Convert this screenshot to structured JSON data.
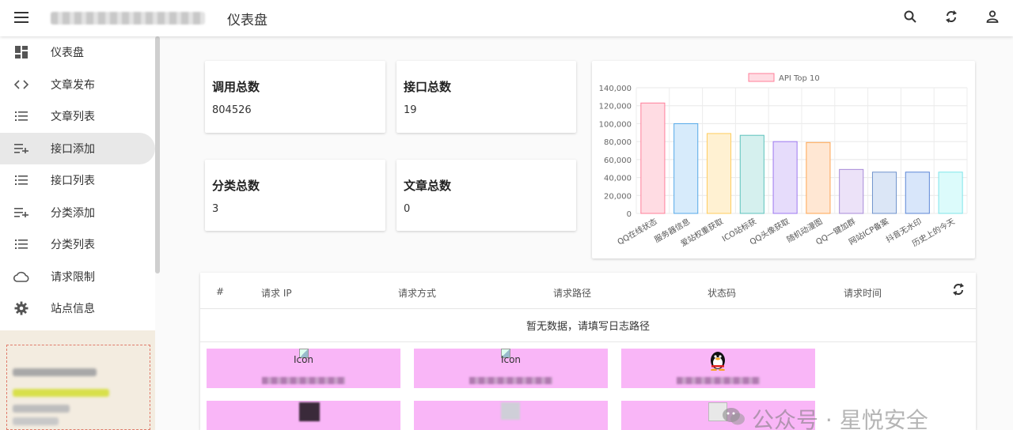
{
  "header": {
    "title": "仪表盘",
    "icons": [
      "menu-icon",
      "search-icon",
      "refresh-icon",
      "account-icon"
    ]
  },
  "sidebar": {
    "items": [
      {
        "label": "仪表盘",
        "icon": "dashboard-icon"
      },
      {
        "label": "文章发布",
        "icon": "code-icon"
      },
      {
        "label": "文章列表",
        "icon": "list-icon"
      },
      {
        "label": "接口添加",
        "icon": "playlist-add-icon",
        "active": true
      },
      {
        "label": "接口列表",
        "icon": "list-icon"
      },
      {
        "label": "分类添加",
        "icon": "playlist-add-icon"
      },
      {
        "label": "分类列表",
        "icon": "list-icon"
      },
      {
        "label": "请求限制",
        "icon": "cloud-icon"
      },
      {
        "label": "站点信息",
        "icon": "gear-icon"
      }
    ]
  },
  "stats": [
    {
      "title": "调用总数",
      "value": "804526"
    },
    {
      "title": "接口总数",
      "value": "19"
    },
    {
      "title": "分类总数",
      "value": "3"
    },
    {
      "title": "文章总数",
      "value": "0"
    }
  ],
  "chart_data": {
    "type": "bar",
    "legend": "API Top 10",
    "legend_position": "top",
    "grid": true,
    "ylim": [
      0,
      140000
    ],
    "yticks": [
      "0",
      "20,000",
      "40,000",
      "60,000",
      "80,000",
      "100,000",
      "120,000",
      "140,000"
    ],
    "categories": [
      "QQ在线状态",
      "服务器信息",
      "爱站权重获取",
      "ICO站标获",
      "QQ头像获取",
      "随机动漫图",
      "QQ一键加群",
      "网站ICP备案",
      "抖音无水印",
      "历史上的今天"
    ],
    "values": [
      123000,
      100000,
      89000,
      87000,
      80000,
      79000,
      49000,
      46000,
      46000,
      46000
    ],
    "colors": [
      {
        "fill": "#ffdce3",
        "stroke": "#ff7f9a"
      },
      {
        "fill": "#d7ebfb",
        "stroke": "#55a9e8"
      },
      {
        "fill": "#fff1d2",
        "stroke": "#ffcd5e"
      },
      {
        "fill": "#d5f0ee",
        "stroke": "#5cc2bc"
      },
      {
        "fill": "#e6dcfb",
        "stroke": "#9d78f0"
      },
      {
        "fill": "#ffe7d3",
        "stroke": "#ffa552"
      },
      {
        "fill": "#ece2f8",
        "stroke": "#a78bd8"
      },
      {
        "fill": "#dbe6f6",
        "stroke": "#6f93cc"
      },
      {
        "fill": "#d8e6fa",
        "stroke": "#5b86d6"
      },
      {
        "fill": "#dcfbfb",
        "stroke": "#7fe5ea"
      }
    ]
  },
  "table": {
    "columns": [
      "#",
      "请求 IP",
      "请求方式",
      "请求路径",
      "状态码",
      "请求时间"
    ],
    "empty_text": "暂无数据，请填写日志路径"
  },
  "tiles": [
    {
      "label": "Icon"
    },
    {
      "label": "Icon"
    },
    {
      "label": ""
    }
  ],
  "watermark": "公众号 · 星悦安全"
}
